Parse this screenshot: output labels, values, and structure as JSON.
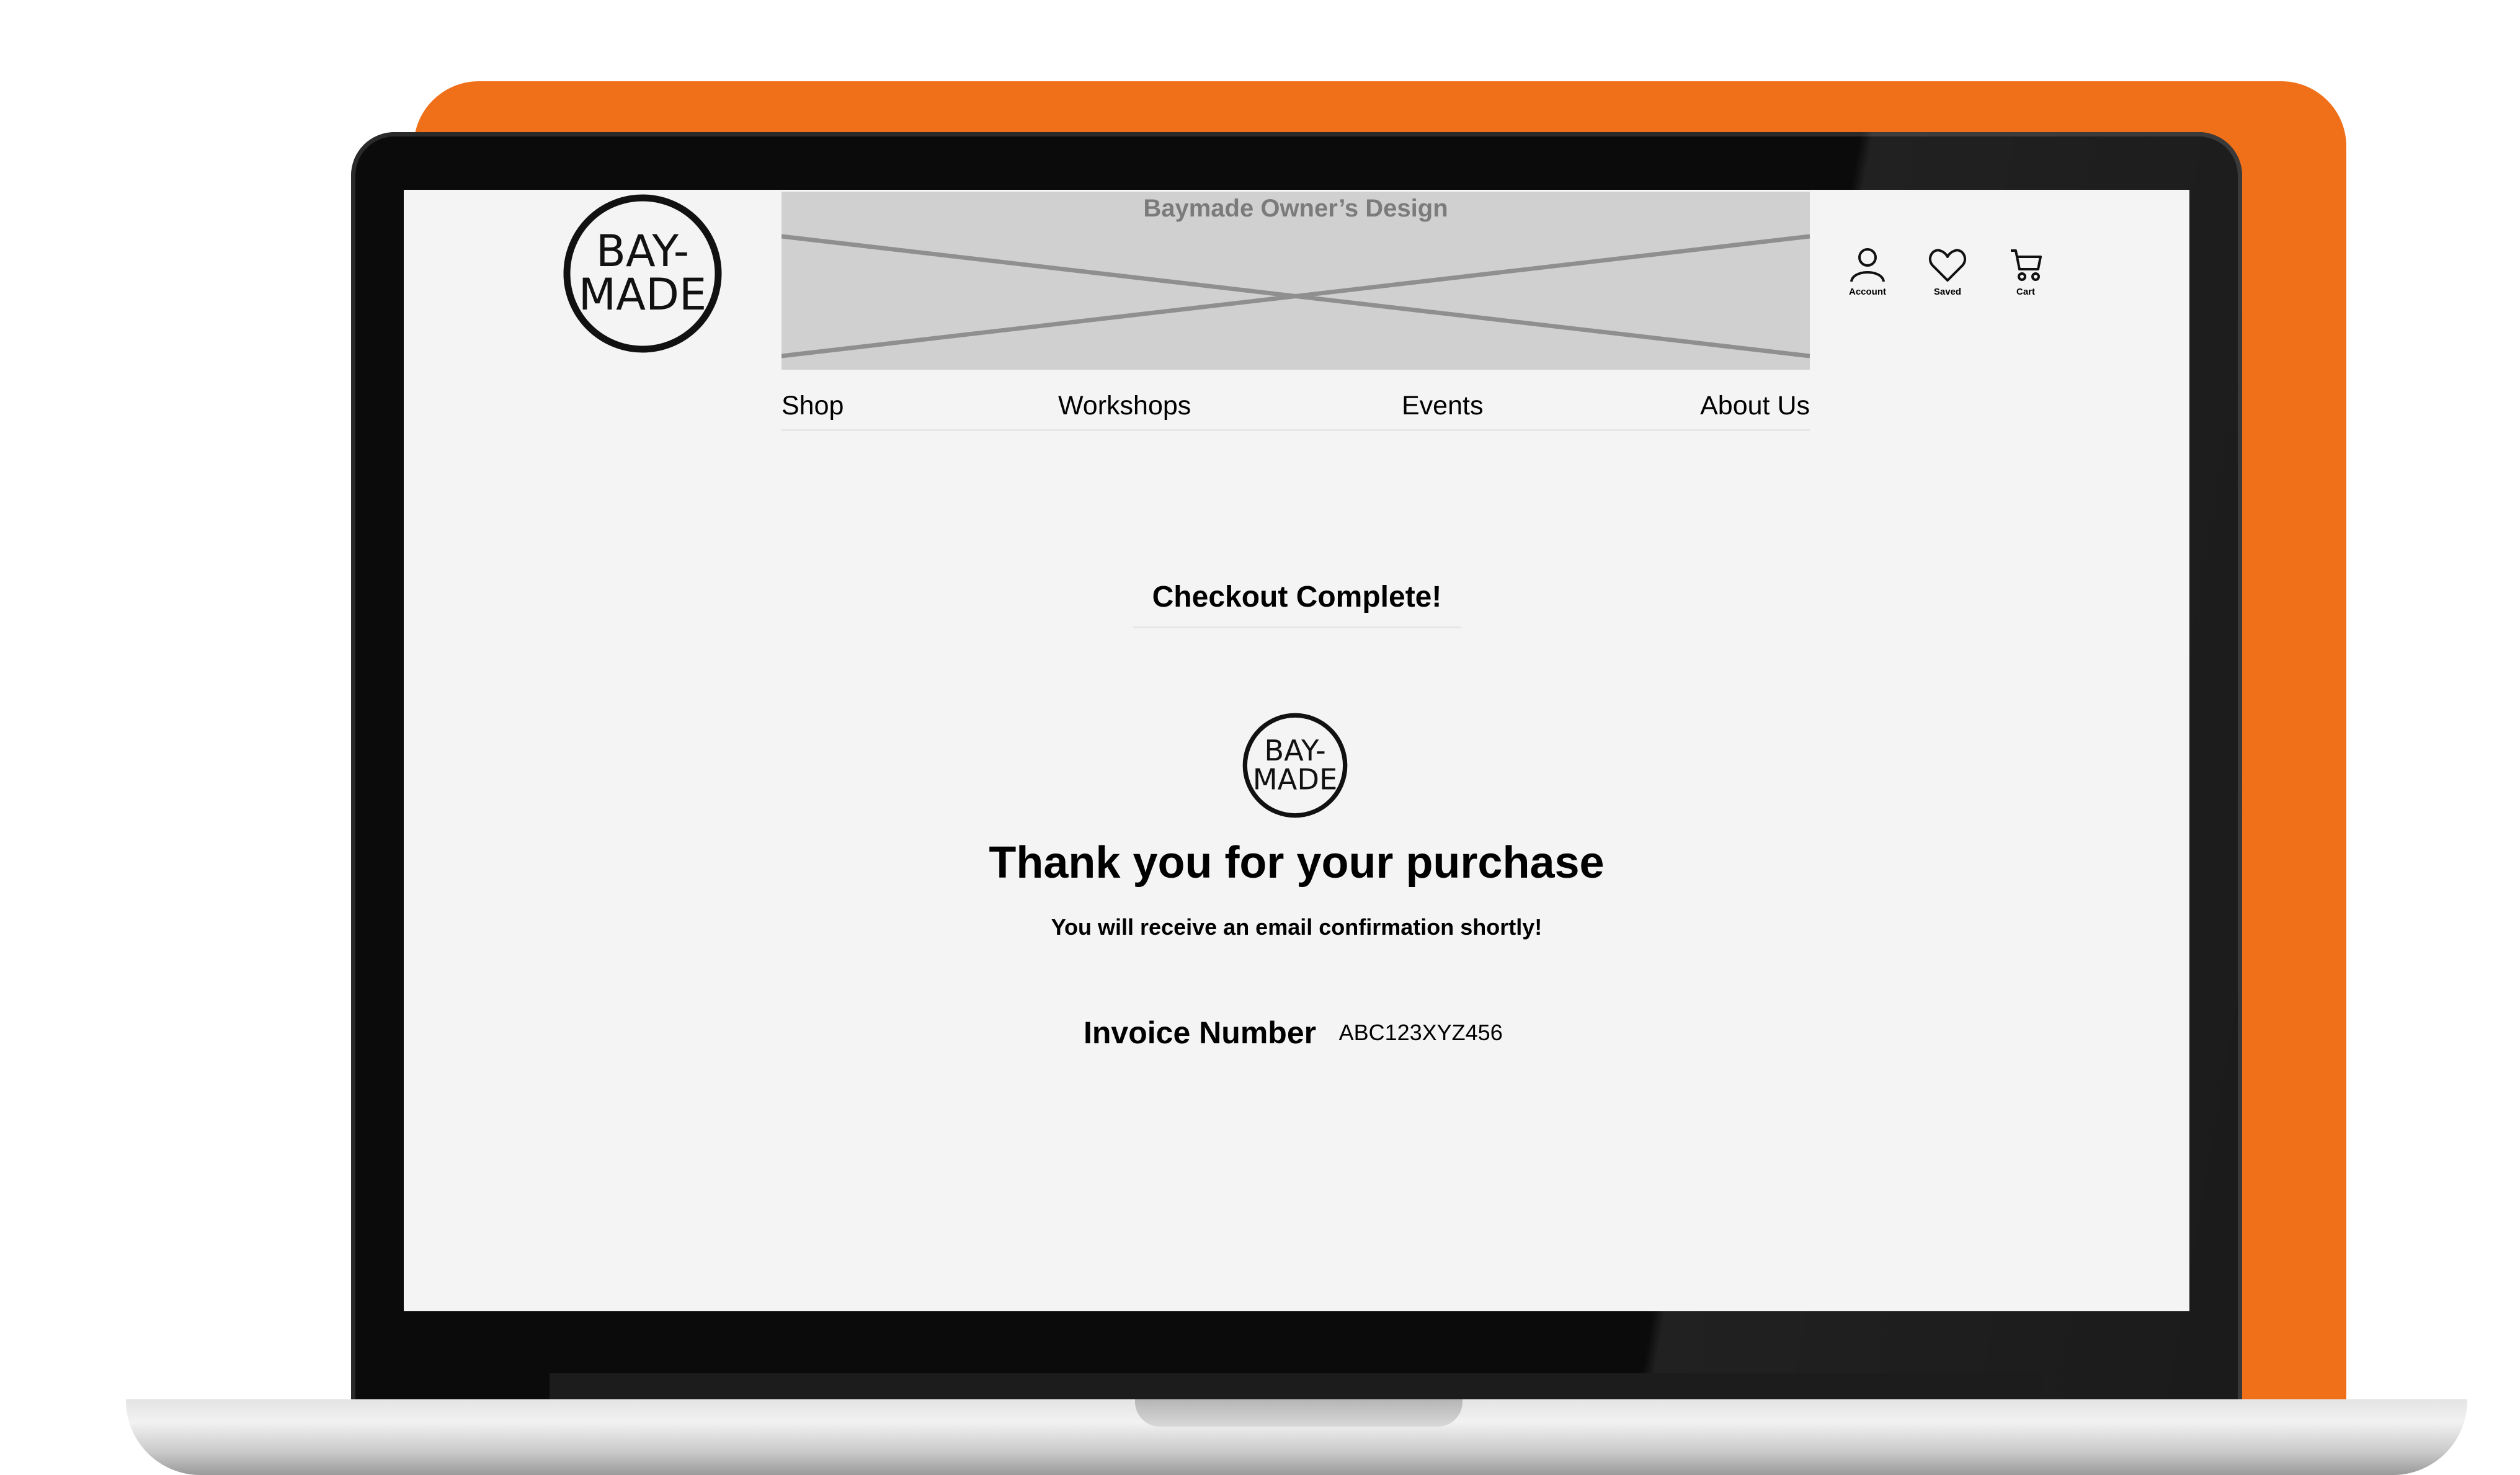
{
  "banner": {
    "title": "Baymade Owner’s Design"
  },
  "brand": {
    "logo_text_top": "BAY-",
    "logo_text_bottom": "MADE",
    "accent": "#f0701a"
  },
  "header_icons": [
    {
      "icon": "account-icon",
      "label": "Account"
    },
    {
      "icon": "heart-icon",
      "label": "Saved"
    },
    {
      "icon": "cart-icon",
      "label": "Cart"
    }
  ],
  "nav": {
    "items": [
      "Shop",
      "Workshops",
      "Events",
      "About Us"
    ]
  },
  "main": {
    "checkout_title": "Checkout Complete!",
    "thanks": "Thank you for your purchase",
    "confirmation": "You will receive an email confirmation shortly!",
    "invoice_label": "Invoice Number",
    "invoice_value": "ABC123XYZ456"
  }
}
